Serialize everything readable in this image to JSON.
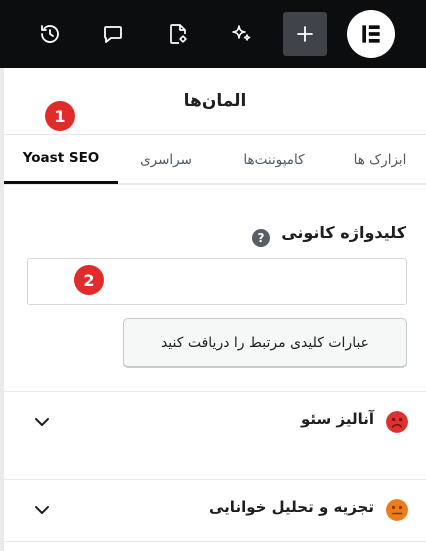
{
  "topbar": {
    "icons": [
      "history-icon",
      "comments-icon",
      "page-settings-icon",
      "ai-sparkle-icon",
      "add-icon",
      "elementor-logo"
    ]
  },
  "panel": {
    "title": "المان‌ها"
  },
  "annotations": {
    "badge1": "1",
    "badge2": "2"
  },
  "tabs": [
    {
      "label": "ابزارک ها"
    },
    {
      "label": "کامپوننت‌ها"
    },
    {
      "label": "سراسری"
    },
    {
      "label": "Yoast SEO",
      "active": true
    }
  ],
  "seo": {
    "focus_keyphrase_label": "کلیدواژه کانونی",
    "help_icon": "?",
    "keyphrase_value": "",
    "related_button_label": "عبارات کلیدی مرتبط را دریافت کنید",
    "sections": [
      {
        "title": "آنالیز سئو",
        "status": "bad",
        "status_color": "#dc3232",
        "icon": "sad-face-icon"
      },
      {
        "title": "تجزیه و تحلیل خوانایی",
        "status": "ok",
        "status_color": "#ee7c1b",
        "icon": "neutral-face-icon"
      }
    ]
  },
  "colors": {
    "topbar": "#0c0d0e",
    "badge": "#e22b2b",
    "add_button": "#404349"
  }
}
